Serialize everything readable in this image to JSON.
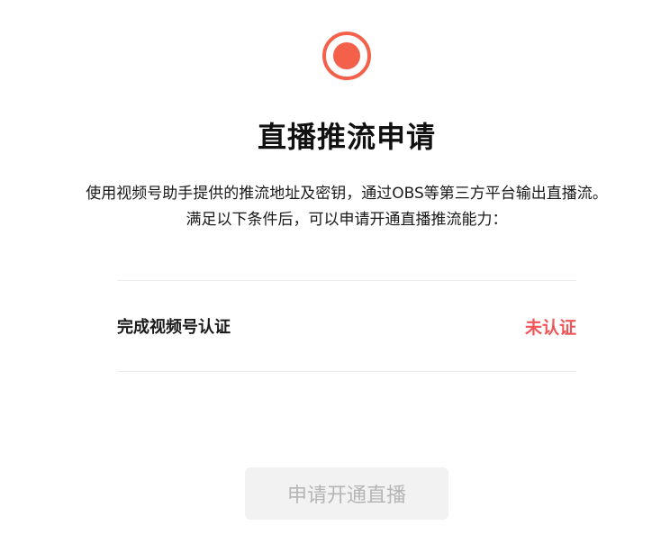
{
  "header": {
    "icon": "live-record-icon",
    "title": "直播推流申请"
  },
  "description": {
    "line1": "使用视频号助手提供的推流地址及密钥，通过OBS等第三方平台输出直播流。",
    "line2": "满足以下条件后，可以申请开通直播推流能力："
  },
  "requirements": [
    {
      "label": "完成视频号认证",
      "status": "未认证"
    }
  ],
  "apply_button": {
    "label": "申请开通直播"
  },
  "colors": {
    "accent": "#f4614b",
    "status_unverified": "#f0555a",
    "button_disabled_bg": "#f2f2f2",
    "button_disabled_text": "#b5b5b5"
  }
}
